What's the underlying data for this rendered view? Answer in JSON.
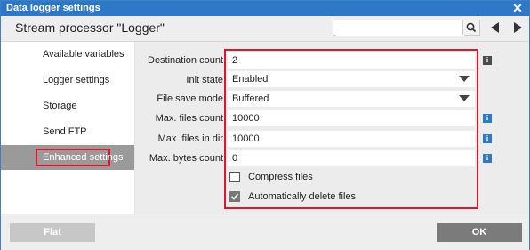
{
  "window": {
    "title": "Data logger settings"
  },
  "header": {
    "title": "Stream processor \"Logger\"",
    "search_value": ""
  },
  "sidebar": {
    "items": [
      {
        "label": "Available variables"
      },
      {
        "label": "Logger settings"
      },
      {
        "label": "Storage"
      },
      {
        "label": "Send FTP"
      },
      {
        "label": "Enhanced settings"
      }
    ],
    "active_index": 4
  },
  "form": {
    "destination_count": {
      "label": "Destination count",
      "value": "2"
    },
    "init_state": {
      "label": "Init state",
      "value": "Enabled"
    },
    "file_save_mode": {
      "label": "File save mode",
      "value": "Buffered"
    },
    "max_files_count": {
      "label": "Max. files count",
      "value": "10000"
    },
    "max_files_in_dir": {
      "label": "Max. files in dir",
      "value": "10000"
    },
    "max_bytes_count": {
      "label": "Max. bytes count",
      "value": "0"
    },
    "compress_files": {
      "label": "Compress files",
      "checked": false
    },
    "auto_delete": {
      "label": "Automatically delete files",
      "checked": true
    },
    "info_glyph": "i"
  },
  "footer": {
    "flat_label": "Flat",
    "ok_label": "OK"
  },
  "colors": {
    "accent": "#2f78c8",
    "highlight": "#d9172d",
    "active_item": "#9a9a9a"
  }
}
